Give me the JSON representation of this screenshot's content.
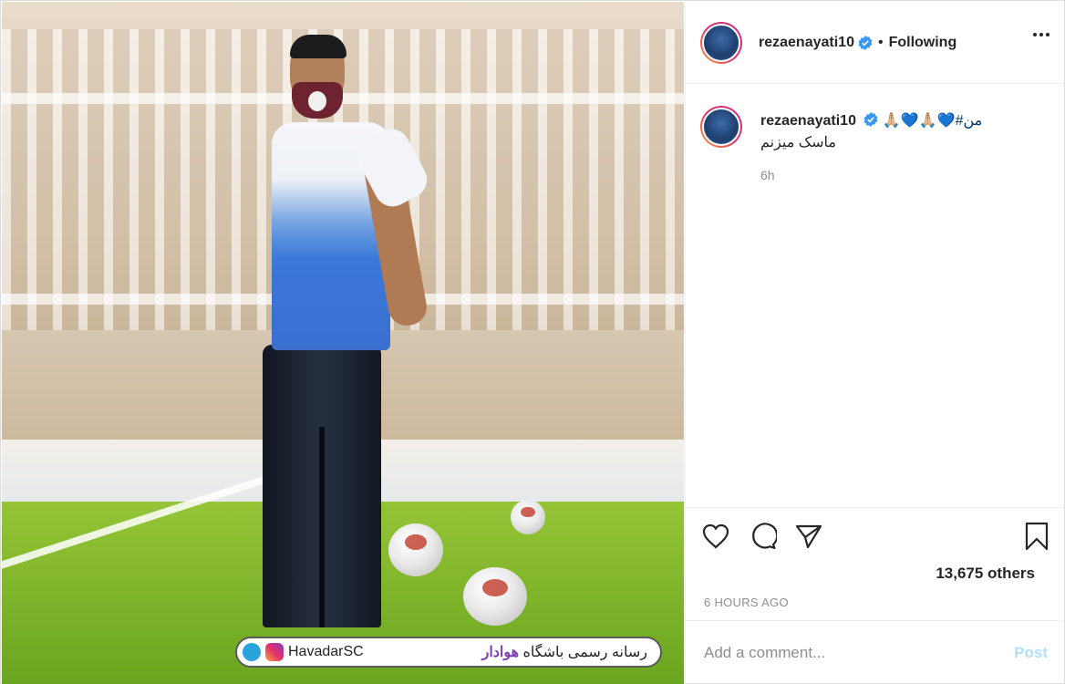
{
  "post": {
    "username": "rezaenayati10",
    "follow_status": "Following",
    "dot": "•",
    "caption_line1": "🙏🏼💙🙏🏼💙#من",
    "caption_line2": "ماسک میزنم",
    "caption_time": "6h",
    "likes_text": "13,675 others",
    "posted_ago": "6 HOURS AGO",
    "comment_placeholder": "Add a comment...",
    "post_label": "Post"
  },
  "watermark": {
    "handle": "HavadarSC",
    "text_prefix": "رسانه رسمی باشگاه ",
    "text_highlight": "هوادار"
  },
  "icons": {
    "verified": "verified-badge-icon",
    "more": "more-options-icon",
    "like": "heart-icon",
    "comment": "comment-bubble-icon",
    "share": "paper-plane-icon",
    "save": "bookmark-icon"
  },
  "colors": {
    "verified": "#3897f0",
    "link": "#00376b",
    "muted": "#8e8e8e",
    "post_disabled": "#b2dffc"
  }
}
